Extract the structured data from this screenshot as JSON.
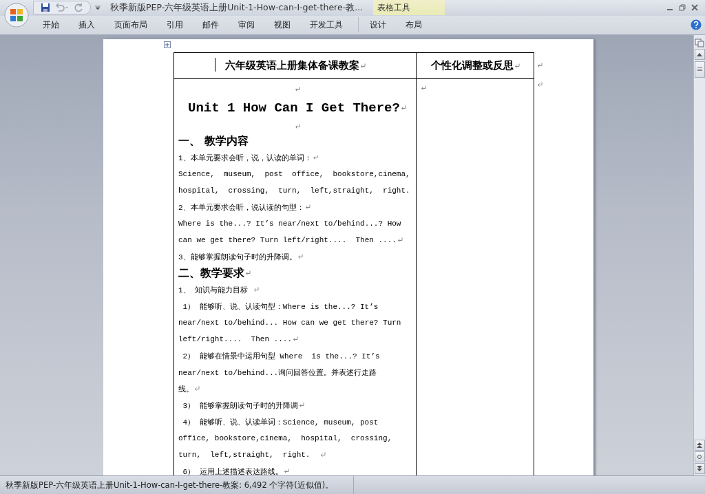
{
  "window": {
    "title": "秋季新版PEP-六年级英语上册Unit-1-How-can-I-get-there-教..."
  },
  "context_tab_group": {
    "label": "表格工具",
    "tabs": [
      {
        "label": "设计",
        "selected": false
      },
      {
        "label": "布局",
        "selected": false
      }
    ]
  },
  "tabs": [
    {
      "label": "开始",
      "selected": false
    },
    {
      "label": "插入",
      "selected": false
    },
    {
      "label": "页面布局",
      "selected": false
    },
    {
      "label": "引用",
      "selected": false
    },
    {
      "label": "邮件",
      "selected": false
    },
    {
      "label": "审阅",
      "selected": false
    },
    {
      "label": "视图",
      "selected": false
    },
    {
      "label": "开发工具",
      "selected": false
    }
  ],
  "document": {
    "table": {
      "headers": [
        {
          "text": "六年级英语上册集体备课教案",
          "para_mark": true
        },
        {
          "text": "个性化调整或反思",
          "para_mark": true
        }
      ],
      "left_cell": [
        {
          "kind": "blank",
          "para_mark": true
        },
        {
          "kind": "title",
          "text": "Unit 1 How Can I Get There?",
          "para_mark": true
        },
        {
          "kind": "blank",
          "para_mark": true
        },
        {
          "kind": "heading",
          "text": "一、 教学内容",
          "para_mark": false
        },
        {
          "kind": "body",
          "text": "1、本单元要求会听，说，认读的单词：",
          "para_mark": true
        },
        {
          "kind": "body",
          "text": "Science,  museum,  post  office,  bookstore,cinema,",
          "para_mark": false
        },
        {
          "kind": "body",
          "text": "hospital,  crossing,  turn,  left,straight,  right.",
          "para_mark": false
        },
        {
          "kind": "body",
          "text": "2、本单元要求会听，说认读的句型：",
          "para_mark": true
        },
        {
          "kind": "body",
          "text": "Where is the...? It’s near/next to/behind...? How",
          "para_mark": false
        },
        {
          "kind": "body",
          "text": "can we get there? Turn left/right....  Then ....",
          "para_mark": true
        },
        {
          "kind": "body",
          "text": "3、能够掌握朗读句子时的升降调。",
          "para_mark": true
        },
        {
          "kind": "heading",
          "text": "二、教学要求",
          "para_mark": true
        },
        {
          "kind": "body",
          "text": "1、 知识与能力目标 ",
          "para_mark": true
        },
        {
          "kind": "body",
          "text": " 1） 能够听、说、认读句型：Where is the...? It’s",
          "para_mark": false
        },
        {
          "kind": "body",
          "text": "near/next to/behind... How can we get there? Turn",
          "para_mark": false
        },
        {
          "kind": "body",
          "text": "left/right....  Then ....",
          "para_mark": true
        },
        {
          "kind": "body",
          "text": " 2） 能够在情景中运用句型 Where  is the...? It’s",
          "para_mark": false
        },
        {
          "kind": "body",
          "text": "near/next to/behind...询问回答位置。并表述行走路",
          "para_mark": false
        },
        {
          "kind": "body",
          "text": "线。",
          "para_mark": true
        },
        {
          "kind": "body",
          "text": " 3） 能够掌握朗读句子时的升降调",
          "para_mark": true
        },
        {
          "kind": "body",
          "text": " 4） 能够听、说、认读单词：Science, museum, post",
          "para_mark": false
        },
        {
          "kind": "body",
          "text": "office, bookstore,cinema,  hospital,  crossing,",
          "para_mark": false
        },
        {
          "kind": "body",
          "text": "turn,  left,straight,  right.  ",
          "para_mark": true
        },
        {
          "kind": "body",
          "text": " 6） 运用上述描述表达路线。",
          "para_mark": true
        }
      ],
      "right_cell_para_mark": true
    }
  },
  "status_bar": {
    "text": "秋季新版PEP-六年级英语上册Unit-1-How-can-I-get-there-教案: 6,492 个字符(近似值)。"
  }
}
